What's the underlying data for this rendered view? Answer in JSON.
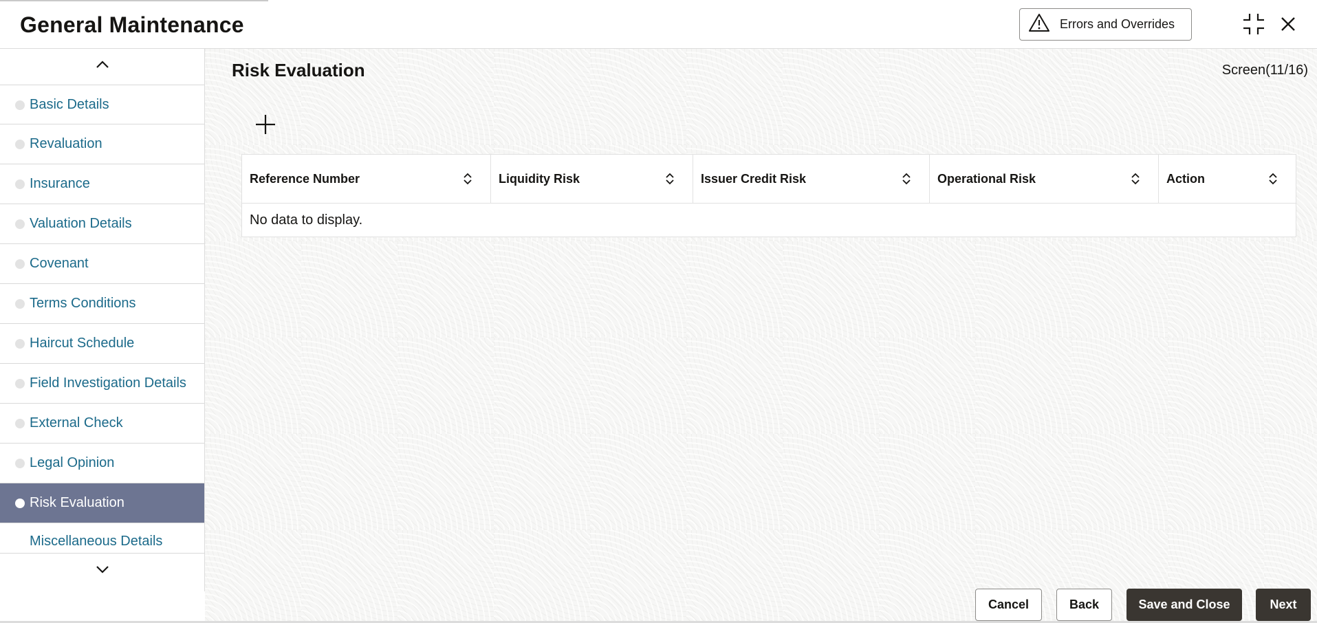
{
  "header": {
    "title": "General Maintenance",
    "errors_button": "Errors and Overrides",
    "icons": {
      "warning": "warning-icon",
      "collapse": "collapse-icon",
      "close": "close-icon"
    }
  },
  "sidebar": {
    "items": [
      {
        "label": "Basic Details",
        "active": false
      },
      {
        "label": "Revaluation",
        "active": false
      },
      {
        "label": "Insurance",
        "active": false
      },
      {
        "label": "Valuation Details",
        "active": false
      },
      {
        "label": "Covenant",
        "active": false
      },
      {
        "label": "Terms Conditions",
        "active": false
      },
      {
        "label": "Haircut Schedule",
        "active": false
      },
      {
        "label": "Field Investigation Details",
        "active": false
      },
      {
        "label": "External Check",
        "active": false
      },
      {
        "label": "Legal Opinion",
        "active": false
      },
      {
        "label": "Risk Evaluation",
        "active": true
      },
      {
        "label": "Miscellaneous Details",
        "active": false
      }
    ]
  },
  "main": {
    "section_title": "Risk Evaluation",
    "screen_counter": "Screen(11/16)",
    "table": {
      "columns": [
        "Reference Number",
        "Liquidity Risk",
        "Issuer Credit Risk",
        "Operational Risk",
        "Action"
      ],
      "empty_text": "No data to display."
    }
  },
  "footer": {
    "cancel": "Cancel",
    "back": "Back",
    "save_close": "Save and Close",
    "next": "Next"
  },
  "colors": {
    "active_nav_bg": "#6d7592",
    "nav_link": "#1b6a8a",
    "dark_button": "#3a3631"
  }
}
